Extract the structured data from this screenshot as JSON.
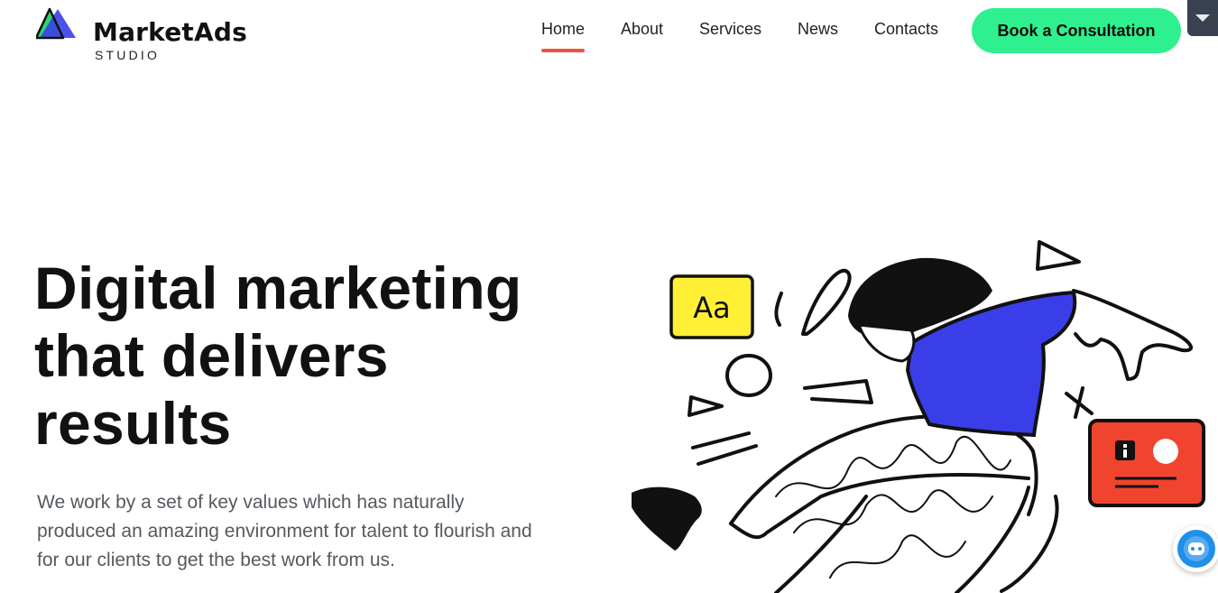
{
  "brand": {
    "name": "MarketAds",
    "subtitle": "STUDIO",
    "colors": {
      "primary": "#3b43e6",
      "accent": "#2fd36d",
      "cta": "#2ff08e",
      "active_underline": "#f0533d"
    }
  },
  "nav": {
    "items": [
      {
        "label": "Home",
        "active": true
      },
      {
        "label": "About",
        "active": false
      },
      {
        "label": "Services",
        "active": false
      },
      {
        "label": "News",
        "active": false
      },
      {
        "label": "Contacts",
        "active": false
      }
    ],
    "cta_label": "Book a Consultation"
  },
  "hero": {
    "title_lines": [
      "Digital marketing",
      "that delivers",
      "results"
    ],
    "description_lines": [
      "We work by a set of key values which has naturally",
      "produced an amazing environment for talent to flourish and",
      "for our clients to get the best work from us."
    ]
  },
  "illustration": {
    "font_card_text": "Aa",
    "colors": {
      "shirt": "#3a3ee8",
      "font_card": "#fff035",
      "red_card": "#f0442f",
      "ink": "#111111"
    }
  },
  "widgets": {
    "corner_tab_icon": "chevron-down-icon",
    "chat_icon": "chat-bot-icon"
  }
}
